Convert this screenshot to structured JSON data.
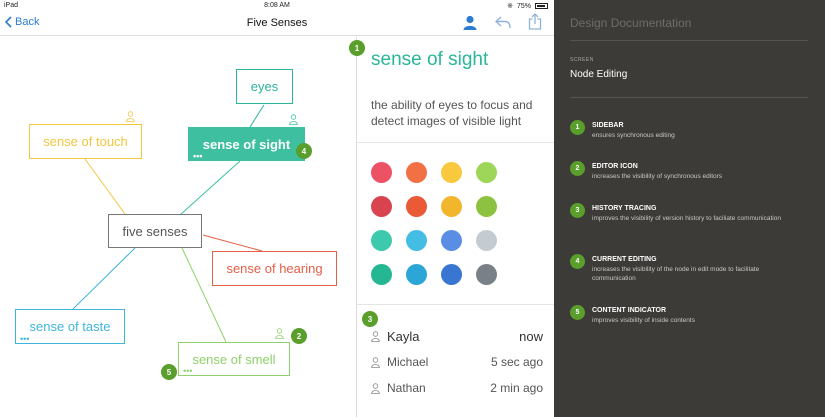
{
  "statusbar": {
    "device": "iPad",
    "time": "8:08 AM",
    "battery": "75%"
  },
  "navbar": {
    "back_label": "Back",
    "title": "Five Senses"
  },
  "mindmap": {
    "center": "five senses",
    "nodes": {
      "eyes": "eyes",
      "sight": "sense of sight",
      "touch": "sense of touch",
      "hearing": "sense of hearing",
      "taste": "sense of taste",
      "smell": "sense of smell"
    },
    "colors": {
      "eyes": "#2bb59a",
      "sight": "#3dbfa0",
      "touch": "#f2c63e",
      "hearing": "#e55f45",
      "taste": "#3fb5dc",
      "smell": "#8fd16a",
      "center": "#777777",
      "badge": "#5a9e2c"
    },
    "badges": {
      "sight": "4",
      "smell_editor": "2",
      "smell_content": "5"
    }
  },
  "detail": {
    "badge": "1",
    "title": "sense of sight",
    "description": "the ability of eyes to focus and detect images of visible light",
    "palette": [
      "#ec5264",
      "#f27144",
      "#f8c83e",
      "#9ed65a",
      "#d9434f",
      "#ea5a36",
      "#f2b62c",
      "#8cc23f",
      "#3cc9ac",
      "#43bde4",
      "#5a8ee5",
      "#c5ccd1",
      "#25b792",
      "#2ba6d6",
      "#3876d1",
      "#7a8088"
    ],
    "history_badge": "3",
    "history": [
      {
        "name": "Kayla",
        "time": "now"
      },
      {
        "name": "Michael",
        "time": "5 sec ago"
      },
      {
        "name": "Nathan",
        "time": "2 min ago"
      }
    ]
  },
  "documentation": {
    "title": "Design Documentation",
    "screen_label": "SCREEN",
    "screen_value": "Node Editing",
    "items": [
      {
        "num": "1",
        "heading": "SIDEBAR",
        "desc": "ensures synchronous editing"
      },
      {
        "num": "2",
        "heading": "EDITOR ICON",
        "desc": "increases the visibility of synchronous editors"
      },
      {
        "num": "3",
        "heading": "HISTORY TRACING",
        "desc": "improves the visibility of version history to faciliate communication"
      },
      {
        "num": "4",
        "heading": "CURRENT EDITING",
        "desc": "increases the visibility of the node in edit mode to facilitate communication"
      },
      {
        "num": "5",
        "heading": "CONTENT INDICATOR",
        "desc": "improves visibility of inside contents"
      }
    ]
  }
}
